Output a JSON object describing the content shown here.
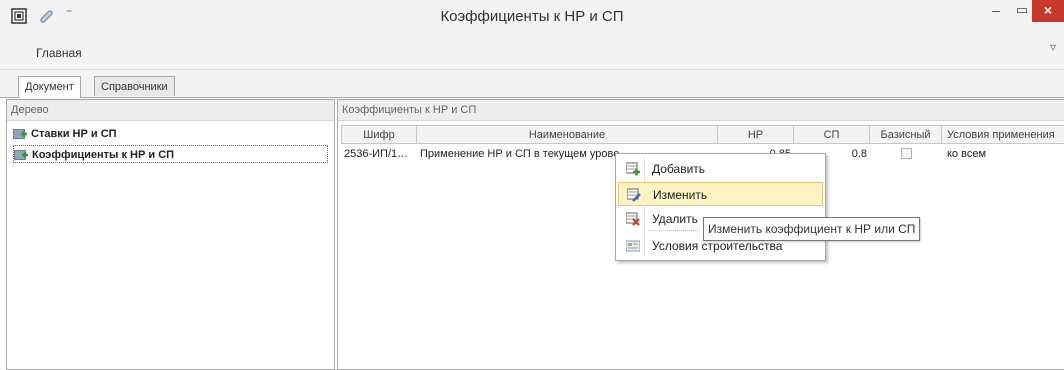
{
  "window": {
    "title": "Коэффициенты к НР и СП",
    "minimize_glyph": "–",
    "maximize_glyph": "▭",
    "close_glyph": "×",
    "accent_close": "#c7392c"
  },
  "ribbon": {
    "tab_label": "Главная",
    "collapse_glyph": "▿"
  },
  "doc_tabs": [
    {
      "label": "Документ",
      "active": true
    },
    {
      "label": "Справочники",
      "active": false
    }
  ],
  "tree": {
    "header": "Дерево",
    "items": [
      {
        "label": "Ставки НР и СП",
        "selected": false
      },
      {
        "label": "Коэффициенты к НР и СП",
        "selected": true
      }
    ]
  },
  "grid": {
    "header": "Коэффициенты к НР и СП",
    "columns": [
      "Шифр",
      "Наименование",
      "НР",
      "СП",
      "Базисный",
      "Условия применения"
    ],
    "rows": [
      {
        "code": "2536-ИП/1…",
        "name": "Применение НР и СП в текущем урове",
        "nr": "0.85",
        "sp": "0.8",
        "basis": false,
        "conditions": "ко всем"
      }
    ]
  },
  "context_menu": {
    "items": [
      {
        "label": "Добавить",
        "icon": "add-row-icon"
      },
      {
        "label": "Изменить",
        "icon": "edit-row-icon",
        "highlighted": true
      },
      {
        "label": "Удалить",
        "icon": "delete-row-icon"
      },
      {
        "label": "Условия строительства",
        "icon": "construction-conditions-icon"
      }
    ]
  },
  "tooltip": {
    "text": "Изменить коэффициент к НР или СП"
  }
}
